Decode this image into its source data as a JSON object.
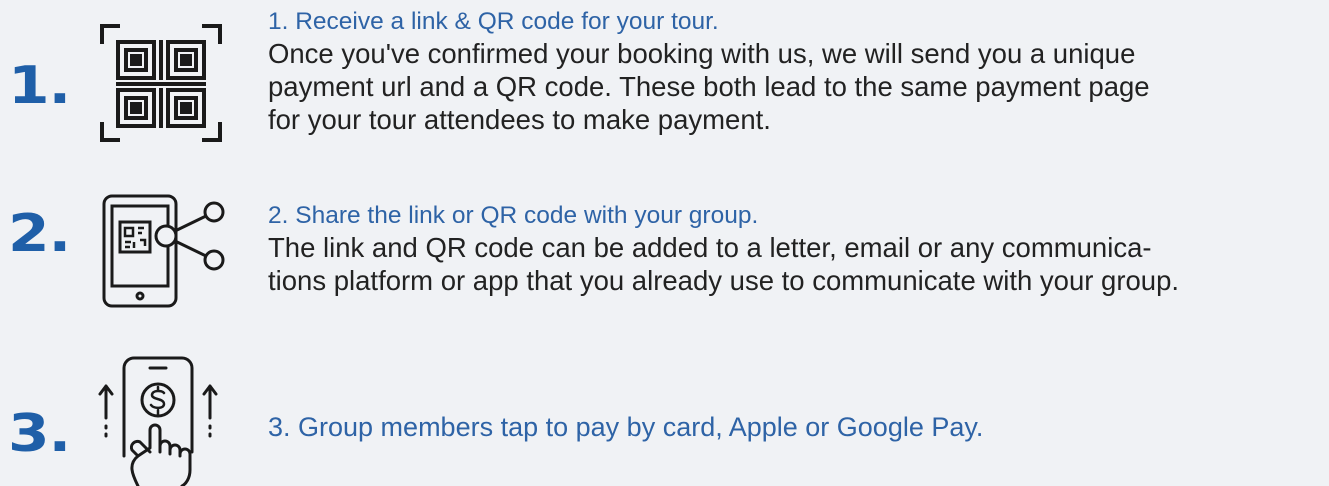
{
  "steps": [
    {
      "number": "1.",
      "icon": "qr-code-icon",
      "title": "1. Receive a link & QR code for your tour.",
      "body_lines": [
        "Once you've confirmed your booking with us, we will send you a unique",
        "payment url and a QR code. These both lead to the same payment page",
        "for your tour attendees to make payment."
      ]
    },
    {
      "number": "2.",
      "icon": "phone-share-icon",
      "title": "2. Share the link or QR code with your group.",
      "body_lines": [
        "The link and QR code can be added to a letter, email or any communica-",
        "tions platform or app that you already use to communicate with your group."
      ]
    },
    {
      "number": "3.",
      "icon": "phone-tap-pay-icon",
      "title": "3. Group members tap to pay by card, Apple or Google Pay.",
      "body_lines": []
    }
  ]
}
